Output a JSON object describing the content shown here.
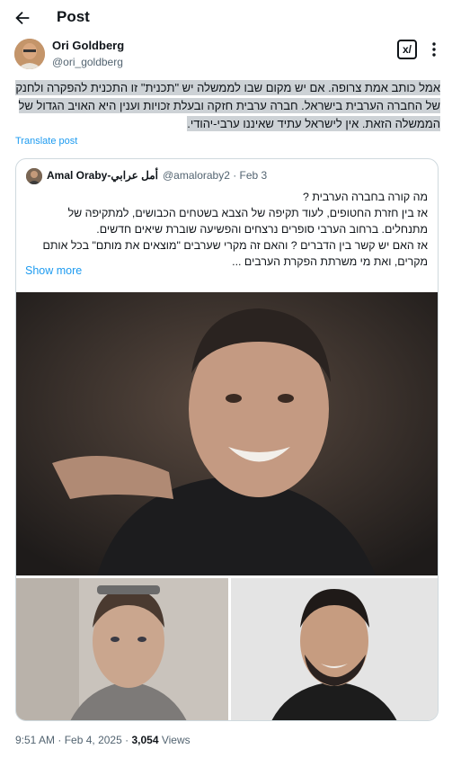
{
  "header": {
    "title": "Post",
    "back_icon": "arrow-left-icon"
  },
  "author": {
    "name": "Ori Goldberg",
    "handle": "@ori_goldberg"
  },
  "post": {
    "text": "אמל כותב אמת צרופה. אם יש מקום שבו לממשלה יש \"תכנית\" זו התכנית להפקרה ולחנק של החברה הערבית בישראל. חברה ערבית חזקה ובעלת זכויות וענין היא האויב הגדול של הממשלה הזאת. אין לישראל עתיד שאיננו ערבי-יהודי.",
    "translate_label": "Translate post"
  },
  "quote": {
    "name": "Amal Oraby-أمل عرابي",
    "meta": "@amaloraby2 · Feb 3",
    "lines": [
      "מה קורה בחברה הערבית ?",
      "אז בין חזרת החטופים, לעוד תקיפה של הצבא בשטחים הכבושים, למתקיפה של מתנחלים. ברחוב הערבי סופרים נרצחים והפשיעה שוברת שיאים חדשים.",
      "אז האם יש קשר בין הדברים ? והאם זה מקרי שערבים \"מוצאים את מותם\" בכל אותם מקרים, ואת מי משרתת הפקרת הערבים ..."
    ],
    "show_more": "Show more"
  },
  "footer": {
    "time": "9:51 AM",
    "sep1": "·",
    "date": "Feb 4, 2025",
    "sep2": "·",
    "views_count": "3,054",
    "views_label": "Views"
  },
  "colors": {
    "accent": "#1d9bf0",
    "secondary_text": "#536471",
    "border": "#cfd9de",
    "highlight": "#cdd2d6"
  }
}
